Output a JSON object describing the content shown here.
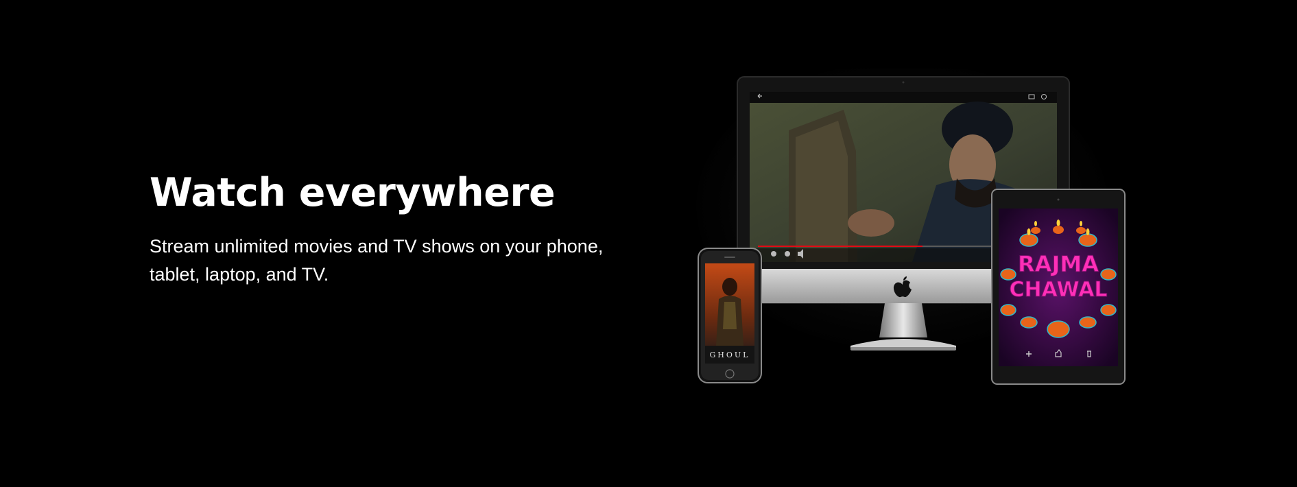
{
  "hero": {
    "title": "Watch everywhere",
    "subtitle": "Stream unlimited movies and TV shows on your phone, tablet, laptop, and TV."
  },
  "devices": {
    "phone_poster_title": "GHOUL",
    "tablet_poster_title_line1": "RAJMA",
    "tablet_poster_title_line2": "CHAWAL",
    "playback_progress": 0.55
  },
  "colors": {
    "background": "#000000",
    "text": "#ffffff",
    "progress_red": "#e50914",
    "poster_pink": "#ff2fb8"
  }
}
